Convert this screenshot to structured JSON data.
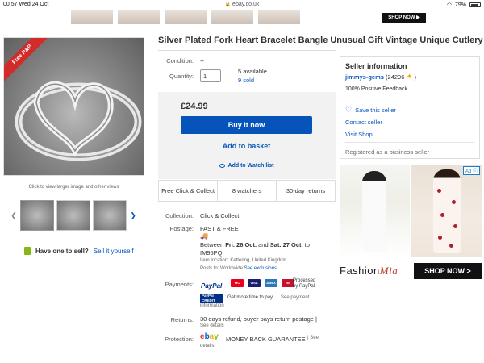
{
  "status_bar": {
    "time": "00:57",
    "date": "Wed 24 Oct",
    "url": "ebay.co.uk",
    "battery": "79%"
  },
  "top_banner": {
    "shop_now": "SHOP NOW ▶"
  },
  "gallery": {
    "ribbon": "Free P&P",
    "caption": "Click to view larger image and other views",
    "prev_icon": "chevron-left-icon",
    "next_icon": "chevron-right-icon"
  },
  "sell": {
    "label": "Have one to sell?",
    "link": "Sell it yourself"
  },
  "listing": {
    "title": "Silver Plated Fork Heart Bracelet Bangle Unusual Gift Vintage Unique Cutlery",
    "condition_label": "Condition:",
    "condition_value": "--",
    "quantity_label": "Quantity:",
    "quantity_value": "1",
    "available": "5 available",
    "sold": "9 sold"
  },
  "buy_box": {
    "price": "£24.99",
    "buy_now": "Buy it now",
    "add_to_basket": "Add to basket",
    "watch_list": "Add to Watch list"
  },
  "stats": {
    "collect": "Free Click & Collect",
    "watchers": "8 watchers",
    "returns": "30-day returns"
  },
  "details": {
    "collection_label": "Collection:",
    "collection_value": "Click & Collect",
    "postage_label": "Postage:",
    "postage_value": "FAST & FREE",
    "between_prefix": "Between ",
    "date_from": "Fri. 26 Oct.",
    "and_text": " and ",
    "date_to": "Sat. 27 Oct.",
    "to_text": " to",
    "postcode": "IM95PQ",
    "item_location": "Item location:  Kettering, United Kingdom",
    "posts_to": "Posts to:  Worldwide",
    "see_exclusions": "See exclusions",
    "payments_label": "Payments:",
    "paypal": "PayPal",
    "processed": "Processed",
    "by_paypal": "by PayPal",
    "more_time": "Get more time to pay.",
    "see_payment": "See payment",
    "information": "information",
    "returns_label": "Returns:",
    "returns_value": "30 days refund, buyer pays return postage |",
    "see_details": "See details",
    "protection_label": "Protection:",
    "mbg": "MONEY BACK GUARANTEE",
    "pipe_see": "| See",
    "details": "details"
  },
  "seller": {
    "heading": "Seller information",
    "name": "jimmys-gems",
    "score": "(24296",
    "score_close": ")",
    "feedback": "100% Positive Feedback",
    "save": "Save this seller",
    "contact": "Contact seller",
    "visit": "Visit Shop",
    "registered": "Registered as a business seller"
  },
  "ad": {
    "badge": "Ad",
    "brand_a": "Fashion",
    "brand_b": "Mia",
    "shop": "SHOP NOW >"
  },
  "colors": {
    "ebay_blue": "#0654ba",
    "ribbon_red": "#d32a2a",
    "paypal_navy": "#003087"
  }
}
